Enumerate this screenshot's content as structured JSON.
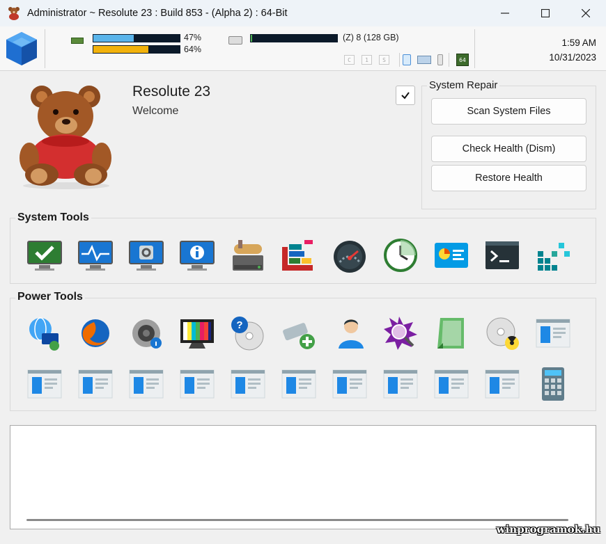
{
  "window": {
    "title": "Administrator ~ Resolute 23 : Build 853 - (Alpha 2) : 64-Bit",
    "minimize_icon": "minimize-icon",
    "maximize_icon": "maximize-icon",
    "close_icon": "close-icon"
  },
  "status": {
    "cpu_percent": "47%",
    "cpu_fill": 0.47,
    "ram_percent": "64%",
    "ram_fill": 0.64,
    "drive_label": "(Z) 8 (128 GB)",
    "drive_fill": 0.02,
    "mini_buttons": [
      "C",
      "1",
      "S"
    ],
    "arch_badge": "64",
    "time": "1:59 AM",
    "date": "10/31/2023"
  },
  "header": {
    "app_name": "Resolute 23",
    "welcome": "Welcome",
    "checkbox_checked": true
  },
  "system_repair": {
    "title": "System Repair",
    "scan_label": "Scan System Files",
    "check_label": "Check Health (Dism)",
    "restore_label": "Restore Health"
  },
  "system_tools": {
    "title": "System Tools",
    "items": [
      "monitor-check-icon",
      "monitor-pulse-icon",
      "monitor-gear-icon",
      "monitor-info-icon",
      "disk-cleanup-icon",
      "defrag-icon",
      "speedometer-icon",
      "clock-icon",
      "system-info-icon",
      "terminal-icon",
      "apps-grid-icon"
    ]
  },
  "power_tools": {
    "title": "Power Tools",
    "items": [
      "network-globe-icon",
      "firefox-browser-icon",
      "speaker-info-icon",
      "color-bars-tv-icon",
      "cd-help-icon",
      "usb-add-icon",
      "user-profile-icon",
      "magnifier-icon",
      "notepad-icon",
      "cd-burn-icon",
      "window-app-icon",
      "window-app-icon",
      "window-app-icon",
      "window-app-icon",
      "window-app-icon",
      "window-app-icon",
      "window-app-icon",
      "window-app-icon",
      "window-app-icon",
      "window-app-icon",
      "window-app-icon",
      "calculator-icon"
    ]
  },
  "log": {
    "text": ""
  },
  "watermark": "winprogramok.hu"
}
